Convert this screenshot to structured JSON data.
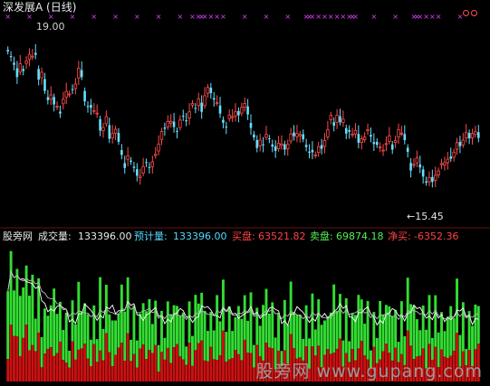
{
  "header": {
    "title": "深发展A (日线)",
    "high_label": "19.00",
    "low_label": "←15.45"
  },
  "indicator": {
    "name": "股旁网",
    "volume_label": "成交量:",
    "volume_value": "133396.00",
    "forecast_label": "预计量:",
    "forecast_value": "133396.00",
    "sell_label": "买盘:",
    "sell_value": "63521.82",
    "buy_label": "卖盘:",
    "buy_value": "69874.18",
    "net_label": "净买:",
    "net_value": "-6352.36"
  },
  "watermark": "股旁网 www.gupang.com",
  "colors": {
    "background": "#000000",
    "up": "#ff4a4a",
    "down": "#66e0ff",
    "signal": "#e040ff",
    "vol_up": "#cc1111",
    "vol_down": "#33dd33",
    "line": "#ffffff",
    "accent_cyan": "#55d8ff",
    "accent_red": "#ff4444",
    "accent_green": "#55ee55"
  },
  "chart_data": [
    {
      "type": "candlestick",
      "title": "深发展A (日线)",
      "ylim": [
        15.1,
        19.3
      ],
      "annotations": [
        {
          "label": "19.00",
          "value": 19.0
        },
        {
          "label": "←15.45",
          "value": 15.45
        }
      ],
      "closes": [
        18.7,
        18.57,
        18.39,
        18.11,
        18.42,
        18.25,
        18.48,
        18.63,
        18.59,
        18.62,
        18.05,
        18.22,
        17.79,
        17.58,
        17.7,
        17.48,
        17.44,
        17.27,
        17.6,
        17.78,
        17.72,
        17.82,
        17.95,
        18.31,
        18.11,
        17.55,
        17.42,
        17.4,
        17.34,
        17.28,
        16.88,
        16.95,
        17.2,
        16.69,
        16.81,
        16.91,
        16.62,
        16.32,
        16.02,
        16.3,
        16.16,
        16.02,
        15.84,
        15.83,
        16.05,
        16.14,
        16.02,
        16.16,
        16.33,
        16.57,
        16.86,
        16.92,
        17.09,
        17.09,
        16.96,
        16.86,
        17.12,
        17.2,
        17.11,
        17.31,
        17.5,
        17.38,
        17.61,
        17.31,
        17.68,
        17.87,
        17.74,
        17.59,
        17.52,
        17.27,
        17.06,
        16.96,
        17.23,
        17.2,
        17.31,
        17.23,
        17.41,
        17.5,
        17.25,
        16.94,
        16.72,
        16.48,
        16.66,
        16.54,
        16.79,
        16.69,
        16.51,
        16.41,
        16.59,
        16.57,
        16.44,
        16.56,
        16.8,
        16.75,
        16.81,
        16.79,
        16.68,
        16.5,
        16.37,
        16.38,
        16.32,
        16.51,
        16.46,
        16.65,
        16.9,
        17.23,
        16.99,
        17.23,
        17.07,
        17.14,
        16.81,
        16.85,
        16.8,
        16.88,
        16.6,
        16.69,
        16.73,
        16.9,
        16.74,
        16.57,
        16.55,
        16.5,
        16.43,
        16.58,
        16.76,
        16.44,
        16.65,
        16.9,
        16.82,
        16.66,
        16.39,
        15.96,
        16.1,
        16.25,
        16.03,
        15.82,
        15.68,
        15.8,
        15.7,
        15.85,
        15.95,
        16.12,
        16.14,
        16.22,
        16.23,
        16.38,
        16.6,
        16.52,
        16.66,
        16.83,
        16.7,
        16.81,
        16.85,
        16.71
      ]
    },
    {
      "type": "bar",
      "title": "股旁网",
      "series": [
        {
          "name": "买盘",
          "value": 63521.82
        },
        {
          "name": "卖盘",
          "value": 69874.18
        }
      ],
      "volume": 133396.0,
      "forecast_volume": 133396.0,
      "net_buy": -6352.36
    }
  ]
}
